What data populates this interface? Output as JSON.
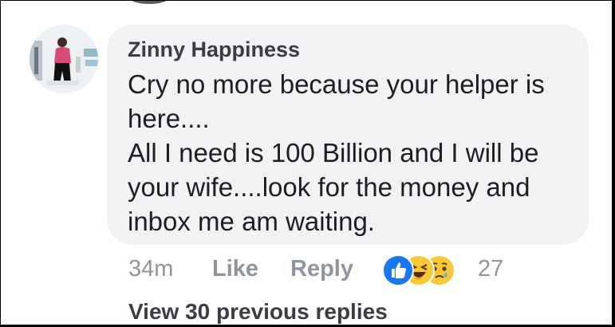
{
  "comment": {
    "author": "Zinny Happiness",
    "text": "Cry no more because your helper is\nhere....\nAll I need is 100 Billion and I will be\nyour wife....look for the money and\ninbox me am waiting.",
    "timestamp": "34m",
    "like_label": "Like",
    "reply_label": "Reply",
    "reactions": [
      "like-icon",
      "haha-icon",
      "sad-icon"
    ],
    "reaction_count": "27"
  },
  "replies": {
    "view_previous_label": "View 30 previous replies"
  },
  "colors": {
    "bubble": "#f1f2f4",
    "meta_text": "#90949c",
    "like_blue": "#1877f2",
    "emoji_yellow": "#f7c93a"
  }
}
